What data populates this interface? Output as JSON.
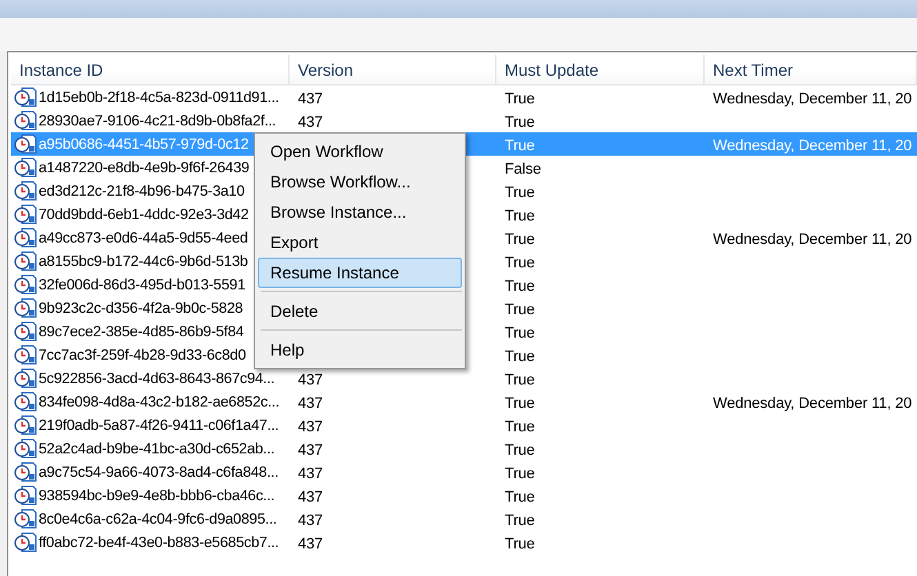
{
  "table": {
    "columns": [
      "Instance ID",
      "Version",
      "Must Update",
      "Next Timer"
    ],
    "rows": [
      {
        "instance_id": "1d15eb0b-2f18-4c5a-823d-0911d91...",
        "version": "437",
        "must_update": "True",
        "next_timer": "Wednesday, December 11, 20",
        "selected": false
      },
      {
        "instance_id": "28930ae7-9106-4c21-8d9b-0b8fa2f...",
        "version": "437",
        "must_update": "True",
        "selected": false
      },
      {
        "instance_id": "a95b0686-4451-4b57-979d-0c12",
        "must_update": "True",
        "next_timer": "Wednesday, December 11, 20",
        "selected": true
      },
      {
        "instance_id": "a1487220-e8db-4e9b-9f6f-26439",
        "must_update": "False",
        "selected": false
      },
      {
        "instance_id": "ed3d212c-21f8-4b96-b475-3a10",
        "must_update": "True",
        "selected": false
      },
      {
        "instance_id": "70dd9bdd-6eb1-4ddc-92e3-3d42",
        "must_update": "True",
        "selected": false
      },
      {
        "instance_id": "a49cc873-e0d6-44a5-9d55-4eed",
        "must_update": "True",
        "next_timer": "Wednesday, December 11, 20",
        "selected": false
      },
      {
        "instance_id": "a8155bc9-b172-44c6-9b6d-513b",
        "must_update": "True",
        "selected": false
      },
      {
        "instance_id": "32fe006d-86d3-495d-b013-5591",
        "must_update": "True",
        "selected": false
      },
      {
        "instance_id": "9b923c2c-d356-4f2a-9b0c-5828",
        "must_update": "True",
        "selected": false
      },
      {
        "instance_id": "89c7ece2-385e-4d85-86b9-5f84",
        "must_update": "True",
        "selected": false
      },
      {
        "instance_id": "7cc7ac3f-259f-4b28-9d33-6c8d0",
        "must_update": "True",
        "selected": false
      },
      {
        "instance_id": "5c922856-3acd-4d63-8643-867c94...",
        "version": "437",
        "must_update": "True",
        "selected": false
      },
      {
        "instance_id": "834fe098-4d8a-43c2-b182-ae6852c...",
        "version": "437",
        "must_update": "True",
        "next_timer": "Wednesday, December 11, 20",
        "selected": false
      },
      {
        "instance_id": "219f0adb-5a87-4f26-9411-c06f1a47...",
        "version": "437",
        "must_update": "True",
        "selected": false
      },
      {
        "instance_id": "52a2c4ad-b9be-41bc-a30d-c652ab...",
        "version": "437",
        "must_update": "True",
        "selected": false
      },
      {
        "instance_id": "a9c75c54-9a66-4073-8ad4-c6fa848...",
        "version": "437",
        "must_update": "True",
        "selected": false
      },
      {
        "instance_id": "938594bc-b9e9-4e8b-bbb6-cba46c...",
        "version": "437",
        "must_update": "True",
        "selected": false
      },
      {
        "instance_id": "8c0e4c6a-c62a-4c04-9fc6-d9a0895...",
        "version": "437",
        "must_update": "True",
        "selected": false
      },
      {
        "instance_id": "ff0abc72-be4f-43e0-b883-e5685cb7...",
        "version": "437",
        "must_update": "True",
        "selected": false
      }
    ]
  },
  "context_menu": {
    "items": [
      {
        "kind": "item",
        "label": "Open Workflow",
        "selected": false
      },
      {
        "kind": "item",
        "label": "Browse Workflow...",
        "selected": false
      },
      {
        "kind": "item",
        "label": "Browse Instance...",
        "selected": false
      },
      {
        "kind": "item",
        "label": "Export",
        "selected": false
      },
      {
        "kind": "item",
        "label": "Resume Instance",
        "selected": true
      },
      {
        "kind": "separator"
      },
      {
        "kind": "item",
        "label": "Delete",
        "selected": false
      },
      {
        "kind": "separator"
      },
      {
        "kind": "item",
        "label": "Help",
        "selected": false
      }
    ]
  }
}
